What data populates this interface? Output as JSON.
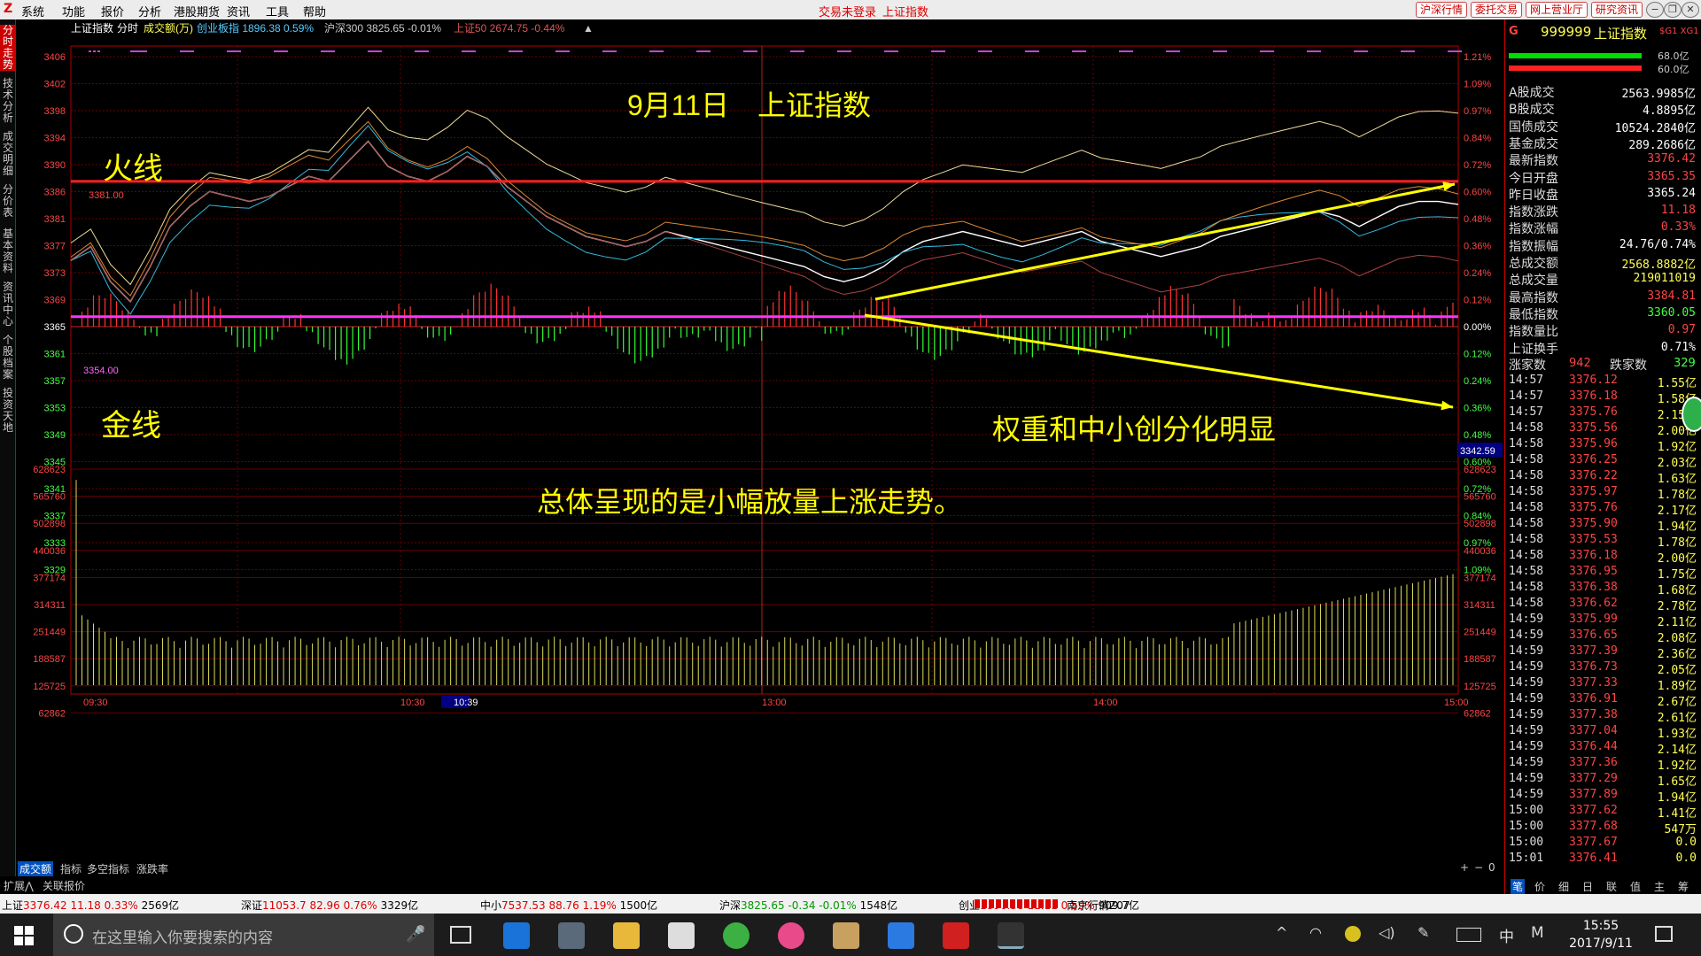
{
  "menubar": {
    "items": [
      "系统",
      "功能",
      "报价",
      "分析",
      "港股期货",
      "资讯",
      "工具",
      "帮助"
    ],
    "center_status": "交易未登录",
    "center_title": "上证指数",
    "right_buttons": [
      "沪深行情",
      "委托交易",
      "网上营业厅",
      "研究资讯"
    ]
  },
  "side_tabs": [
    "分时走势",
    "技术分析",
    "成交明细",
    "分价表",
    "基本资料",
    "资讯中心",
    "个股档案",
    "投资天地"
  ],
  "chart_header": {
    "index_name": "上证指数",
    "mode": "分时",
    "volume_mode": "成交额(万)",
    "chinext": "创业板指 1896.38 0.59%",
    "hs300": "沪深300 3825.65 -0.01%",
    "sz50": "上证50 2674.75 -0.44%"
  },
  "annotations": {
    "title": "9月11日　上证指数",
    "fire_line": "火线",
    "gold_line": "金线",
    "divergence": "权重和中小创分化明显",
    "summary": "总体呈现的是小幅放量上涨走势。",
    "fire_value": "3381.00",
    "gold_value": "3354.00",
    "cursor_value": "3342.59"
  },
  "chart_data": {
    "type": "line",
    "title": "9月11日　上证指数",
    "price_axis": [
      "3406",
      "3402",
      "3398",
      "3394",
      "3390",
      "3386",
      "3381",
      "3377",
      "3373",
      "3369",
      "3365",
      "3361",
      "3357",
      "3353",
      "3349",
      "3345",
      "3341",
      "3337",
      "3333",
      "3329"
    ],
    "pct_axis": [
      "1.21%",
      "1.09%",
      "0.97%",
      "0.84%",
      "0.72%",
      "0.60%",
      "0.48%",
      "0.36%",
      "0.24%",
      "0.12%",
      "0.00%",
      "0.12%",
      "0.24%",
      "0.36%",
      "0.48%",
      "0.60%",
      "0.72%",
      "0.84%",
      "0.97%",
      "1.09%"
    ],
    "volume_axis": [
      "628623",
      "565760",
      "502898",
      "440036",
      "377174",
      "314311",
      "251449",
      "188587",
      "125725",
      "62862"
    ],
    "time_axis": [
      "09:30",
      "10:30",
      "10:39",
      "13:00",
      "14:00",
      "15:00"
    ],
    "prev_close": 3365.24,
    "fire_line": 3381.0,
    "gold_line": 3354.0,
    "series": [
      {
        "name": "上证指数",
        "values": [
          3365.2,
          3368,
          3361,
          3357,
          3364,
          3372,
          3376,
          3379,
          3378,
          3377,
          3378,
          3380,
          3382,
          3381,
          3385,
          3389,
          3384,
          3382,
          3381,
          3383,
          3386,
          3384,
          3380,
          3377,
          3374,
          3372,
          3370,
          3369,
          3368,
          3369,
          3371,
          3370,
          3369,
          3368,
          3367,
          3366,
          3365,
          3364,
          3362,
          3361,
          3362,
          3364,
          3367,
          3369,
          3370,
          3371,
          3370,
          3369,
          3368,
          3369,
          3370,
          3371,
          3369,
          3368,
          3367,
          3366,
          3367,
          3368,
          3370,
          3371,
          3372,
          3373,
          3374,
          3375,
          3374,
          3372,
          3374,
          3376,
          3377,
          3377,
          3376.4
        ]
      }
    ]
  },
  "bottom_tabs": [
    "成交额",
    "指标",
    "多空指标",
    "涨跌率"
  ],
  "bottom_tabs2": [
    "扩展⋀",
    "关联报价"
  ],
  "right_panel": {
    "code": "999999",
    "name": "上证指数",
    "badge": "$G1 XG1",
    "bar_vals": [
      "68.0亿",
      "60.0亿"
    ],
    "rows": [
      {
        "label": "A股成交",
        "value": "2563.9985亿",
        "color": "#ffffff"
      },
      {
        "label": "B股成交",
        "value": "4.8895亿",
        "color": "#ffffff"
      },
      {
        "label": "国债成交",
        "value": "10524.2840亿",
        "color": "#ffffff"
      },
      {
        "label": "基金成交",
        "value": "289.2686亿",
        "color": "#ffffff"
      },
      {
        "label": "最新指数",
        "value": "3376.42",
        "color": "#ff4444"
      },
      {
        "label": "今日开盘",
        "value": "3365.35",
        "color": "#ff4444"
      },
      {
        "label": "昨日收盘",
        "value": "3365.24",
        "color": "#ffffff"
      },
      {
        "label": "指数涨跌",
        "value": "11.18",
        "color": "#ff4444"
      },
      {
        "label": "指数涨幅",
        "value": "0.33%",
        "color": "#ff4444"
      },
      {
        "label": "指数振幅",
        "value": "24.76/0.74%",
        "color": "#ffffff"
      },
      {
        "label": "总成交额",
        "value": "2568.8882亿",
        "color": "#ffff55"
      },
      {
        "label": "总成交量",
        "value": "219011019",
        "color": "#ffff55"
      },
      {
        "label": "最高指数",
        "value": "3384.81",
        "color": "#ff4444"
      },
      {
        "label": "最低指数",
        "value": "3360.05",
        "color": "#44ff44"
      },
      {
        "label": "指数量比",
        "value": "0.97",
        "color": "#ff4444"
      },
      {
        "label": "上证换手",
        "value": "0.71%",
        "color": "#ffffff"
      }
    ],
    "up_label": "涨家数",
    "up_count": "942",
    "down_label": "跌家数",
    "down_count": "329",
    "ticks": [
      {
        "t": "14:57",
        "p": "3376.12",
        "v": "1.55亿"
      },
      {
        "t": "14:57",
        "p": "3376.18",
        "v": "1.58亿"
      },
      {
        "t": "14:57",
        "p": "3375.76",
        "v": "2.15亿"
      },
      {
        "t": "14:58",
        "p": "3375.56",
        "v": "2.00亿"
      },
      {
        "t": "14:58",
        "p": "3375.96",
        "v": "1.92亿"
      },
      {
        "t": "14:58",
        "p": "3376.25",
        "v": "2.03亿"
      },
      {
        "t": "14:58",
        "p": "3376.22",
        "v": "1.63亿"
      },
      {
        "t": "14:58",
        "p": "3375.97",
        "v": "1.78亿"
      },
      {
        "t": "14:58",
        "p": "3375.76",
        "v": "2.17亿"
      },
      {
        "t": "14:58",
        "p": "3375.90",
        "v": "1.94亿"
      },
      {
        "t": "14:58",
        "p": "3375.53",
        "v": "1.78亿"
      },
      {
        "t": "14:58",
        "p": "3376.18",
        "v": "2.00亿"
      },
      {
        "t": "14:58",
        "p": "3376.95",
        "v": "1.75亿"
      },
      {
        "t": "14:58",
        "p": "3376.38",
        "v": "1.68亿"
      },
      {
        "t": "14:58",
        "p": "3376.62",
        "v": "2.78亿"
      },
      {
        "t": "14:59",
        "p": "3375.99",
        "v": "2.11亿"
      },
      {
        "t": "14:59",
        "p": "3376.65",
        "v": "2.08亿"
      },
      {
        "t": "14:59",
        "p": "3377.39",
        "v": "2.36亿"
      },
      {
        "t": "14:59",
        "p": "3376.73",
        "v": "2.05亿"
      },
      {
        "t": "14:59",
        "p": "3377.33",
        "v": "1.89亿"
      },
      {
        "t": "14:59",
        "p": "3376.91",
        "v": "2.67亿"
      },
      {
        "t": "14:59",
        "p": "3377.38",
        "v": "2.61亿"
      },
      {
        "t": "14:59",
        "p": "3377.04",
        "v": "1.93亿"
      },
      {
        "t": "14:59",
        "p": "3376.44",
        "v": "2.14亿"
      },
      {
        "t": "14:59",
        "p": "3377.36",
        "v": "1.92亿"
      },
      {
        "t": "14:59",
        "p": "3377.29",
        "v": "1.65亿"
      },
      {
        "t": "14:59",
        "p": "3377.89",
        "v": "1.94亿"
      },
      {
        "t": "15:00",
        "p": "3377.62",
        "v": "1.41亿"
      },
      {
        "t": "15:00",
        "p": "3377.68",
        "v": "547万"
      },
      {
        "t": "15:00",
        "p": "3377.67",
        "v": "0.0"
      },
      {
        "t": "15:01",
        "p": "3376.41",
        "v": "0.0"
      }
    ],
    "bottom_tabs": [
      "笔",
      "价",
      "细",
      "日",
      "联",
      "值",
      "主",
      "筹"
    ]
  },
  "statusbar": {
    "items": [
      {
        "name": "上证",
        "val": "3376.42",
        "chg": "11.18",
        "pct": "0.33%",
        "amt": "2569亿"
      },
      {
        "name": "深证",
        "val": "11053.7",
        "chg": "82.96",
        "pct": "0.76%",
        "amt": "3329亿"
      },
      {
        "name": "中小",
        "val": "7537.53",
        "chg": "88.76",
        "pct": "1.19%",
        "amt": "1500亿"
      },
      {
        "name": "沪深",
        "val": "3825.65",
        "chg": "-0.34",
        "pct": "-0.01%",
        "amt": "1548亿"
      },
      {
        "name": "创业",
        "val": "1896.38",
        "chg": "11.11",
        "pct": "0.59%",
        "amt": "909.7亿"
      }
    ],
    "server": "南京行情Z07"
  },
  "taskbar": {
    "search_placeholder": "在这里输入你要搜索的内容",
    "time": "15:55",
    "date": "2017/9/11",
    "ime": "中",
    "ime2": "M"
  }
}
